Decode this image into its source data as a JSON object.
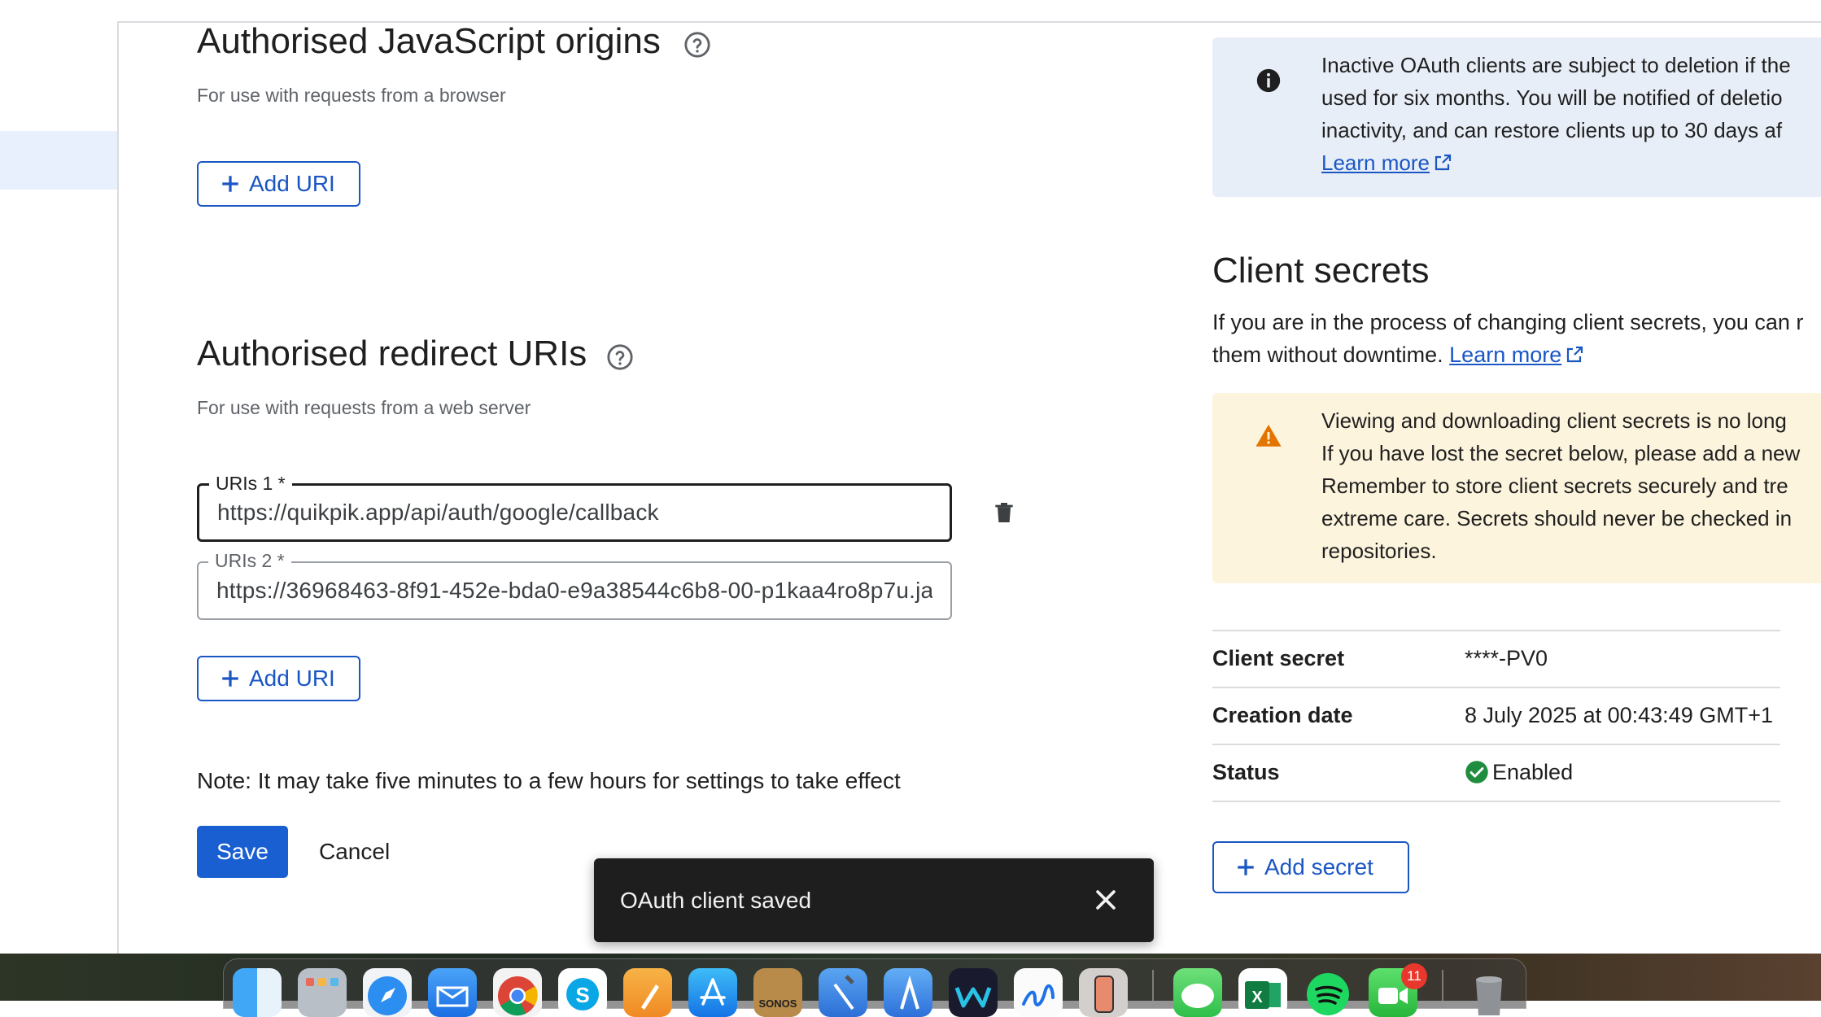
{
  "js_origins": {
    "title": "Authorised JavaScript origins",
    "subtitle": "For use with requests from a browser",
    "add_label": "Add URI"
  },
  "redirect": {
    "title": "Authorised redirect URIs",
    "subtitle": "For use with requests from a web server",
    "uris": [
      {
        "label": "URIs 1 *",
        "value": "https://quikpik.app/api/auth/google/callback"
      },
      {
        "label": "URIs 2 *",
        "value": "https://36968463-8f91-452e-bda0-e9a38544c6b8-00-p1kaa4ro8p7u.ja"
      }
    ],
    "add_label": "Add URI"
  },
  "note": "Note: It may take five minutes to a few hours for settings to take effect",
  "actions": {
    "save": "Save",
    "cancel": "Cancel"
  },
  "snackbar": {
    "message": "OAuth client saved"
  },
  "info": {
    "lines": [
      "Inactive OAuth clients are subject to deletion if the",
      "used for six months. You will be notified of deletio",
      "inactivity, and can restore clients up to 30 days af"
    ],
    "link": "Learn more"
  },
  "secrets": {
    "title": "Client secrets",
    "para_line1": "If you are in the process of changing client secrets, you can r",
    "para_line2": "them without downtime.",
    "link": "Learn more",
    "warning_lines": [
      "Viewing and downloading client secrets is no long",
      "If you have lost the secret below, please add a new",
      "Remember to store client secrets securely and tre",
      "extreme care. Secrets should never be checked in",
      "repositories."
    ],
    "rows": [
      {
        "key": "Client secret",
        "value": "****-PV0"
      },
      {
        "key": "Creation date",
        "value": "8 July 2025 at 00:43:49 GMT+1"
      },
      {
        "key": "Status",
        "value": "Enabled"
      }
    ],
    "add_label": "Add secret"
  },
  "colors": {
    "accent": "#1a56c4",
    "save_bg": "#1a5fd1",
    "info_bg": "#e8eef7",
    "warn_bg": "#fdf4dd",
    "warn_icon": "#e37400",
    "enabled": "#1e8e3e"
  },
  "dock": {
    "icons": [
      "finder-icon",
      "launchpad-icon",
      "safari-icon",
      "mail-icon",
      "chrome-icon",
      "skype-icon",
      "pages-icon",
      "app-store-icon",
      "sonos-icon",
      "xcode-icon",
      "simulator-icon",
      "webex-icon",
      "freeform-icon",
      "iphone-mirroring-icon",
      "messages-icon",
      "excel-icon",
      "spotify-icon",
      "facetime-icon",
      "trash-icon"
    ],
    "sonos_label": "SONOS",
    "badge": "11"
  }
}
